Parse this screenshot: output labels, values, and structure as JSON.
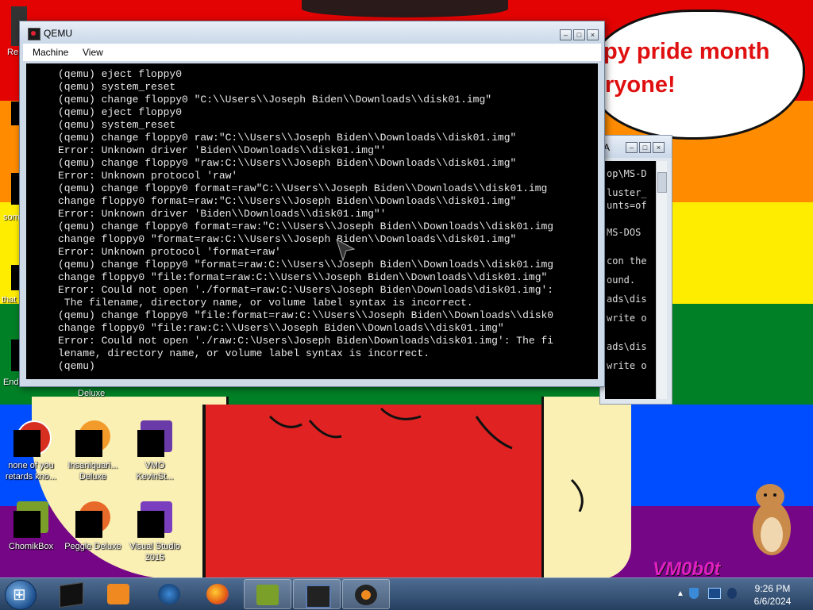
{
  "desktop": {
    "bubble_lines": [
      "py pride month",
      "ryone!"
    ],
    "watermark": "VM0b0t",
    "icons": [
      {
        "label": "none of you retards kno...",
        "name": "none-of-you-icon"
      },
      {
        "label": "Insaniquari... Deluxe",
        "name": "insaniquarium-icon"
      },
      {
        "label": "VMO KevinSt...",
        "name": "vmo-kevinst-icon"
      },
      {
        "label": "ChomikBox",
        "name": "chomikbox-icon"
      },
      {
        "label": "Peggle Deluxe",
        "name": "peggle-deluxe-icon"
      },
      {
        "label": "Visual Studio 2015",
        "name": "visual-studio-icon"
      }
    ],
    "partial_labels": {
      "recycle": "Re",
      "some": "som",
      "that": "that",
      "end": "End",
      "deluxe": "Deluxe"
    }
  },
  "qemu_window": {
    "title": "QEMU",
    "menu": [
      "Machine",
      "View"
    ],
    "console_lines": [
      "(qemu) eject floppy0",
      "(qemu) system_reset",
      "(qemu) change floppy0 \"C:\\\\Users\\\\Joseph Biden\\\\Downloads\\\\disk01.img\"",
      "(qemu) eject floppy0",
      "(qemu) system_reset",
      "(qemu) change floppy0 raw:\"C:\\\\Users\\\\Joseph Biden\\\\Downloads\\\\disk01.img\"",
      "Error: Unknown driver 'Biden\\\\Downloads\\\\disk01.img\"'",
      "(qemu) change floppy0 \"raw:C:\\\\Users\\\\Joseph Biden\\\\Downloads\\\\disk01.img\"",
      "Error: Unknown protocol 'raw'",
      "(qemu) change floppy0 format=raw\"C:\\\\Users\\\\Joseph Biden\\\\Downloads\\\\disk01.img",
      "change floppy0 format=raw:\"C:\\\\Users\\\\Joseph Biden\\\\Downloads\\\\disk01.img\"",
      "Error: Unknown driver 'Biden\\\\Downloads\\\\disk01.img\"'",
      "(qemu) change floppy0 format=raw:\"C:\\\\Users\\\\Joseph Biden\\\\Downloads\\\\disk01.img",
      "change floppy0 \"format=raw:C:\\\\Users\\\\Joseph Biden\\\\Downloads\\\\disk01.img\"",
      "Error: Unknown protocol 'format=raw'",
      "(qemu) change floppy0 \"format=raw:C:\\\\Users\\\\Joseph Biden\\\\Downloads\\\\disk01.img",
      "change floppy0 \"file:format=raw:C:\\\\Users\\\\Joseph Biden\\\\Downloads\\\\disk01.img\"",
      "Error: Could not open './format=raw:C:\\Users\\Joseph Biden\\Downloads\\disk01.img':",
      " The filename, directory name, or volume label syntax is incorrect.",
      "(qemu) change floppy0 \"file:format=raw:C:\\\\Users\\\\Joseph Biden\\\\Downloads\\\\disk0",
      "change floppy0 \"file:raw:C:\\\\Users\\\\Joseph Biden\\\\Downloads\\\\disk01.img\"",
      "Error: Could not open './raw:C:\\Users\\Joseph Biden\\Downloads\\disk01.img': The fi",
      "lename, directory name, or volume label syntax is incorrect.",
      "(qemu)"
    ]
  },
  "back_window": {
    "title_fragment": "A",
    "console_fragments": [
      "op\\MS-D",
      "luster_",
      "unts=of",
      "MS-DOS",
      "con the",
      "ound.",
      "ads\\dis",
      "write o",
      "ads\\dis",
      "write o"
    ]
  },
  "taskbar": {
    "buttons": [
      {
        "name": "taskbar-black-window-icon"
      },
      {
        "name": "taskbar-media-player-icon"
      },
      {
        "name": "taskbar-globe-icon"
      },
      {
        "name": "taskbar-firefox-icon"
      },
      {
        "name": "taskbar-chomikbox-icon"
      },
      {
        "name": "taskbar-monitor-icon"
      },
      {
        "name": "taskbar-qemu-icon"
      }
    ],
    "clock_time": "9:26 PM",
    "clock_date": "6/6/2024"
  },
  "colors": {
    "stripe_red": "#e40303",
    "stripe_orange": "#ff8c00",
    "stripe_yellow": "#ffed00",
    "stripe_green": "#008026",
    "stripe_blue": "#004dff",
    "stripe_purple": "#750787",
    "bubble_text": "#e01010",
    "watermark": "#e020c0"
  }
}
